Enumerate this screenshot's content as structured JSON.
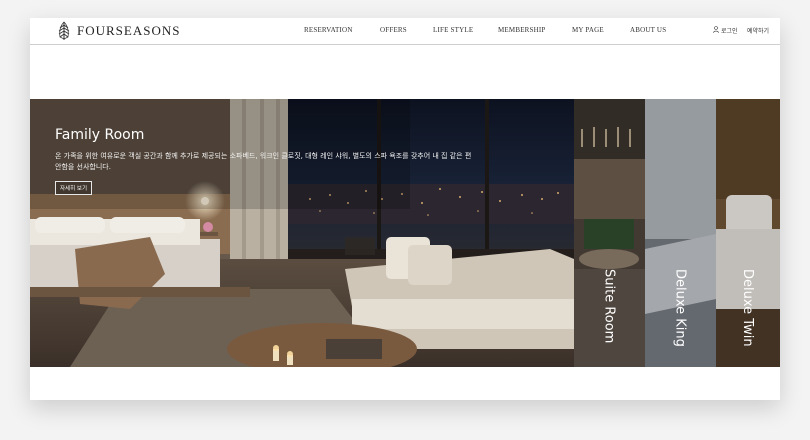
{
  "brand": {
    "name": "FOURSEASONS"
  },
  "nav": {
    "items": [
      "RESERVATION",
      "OFFERS",
      "LIFE STYLE",
      "MEMBERSHIP",
      "MY PAGE",
      "ABOUT US"
    ]
  },
  "utility": {
    "login_label": "로그인",
    "reserve_label": "예약하기"
  },
  "hero": {
    "active": {
      "title": "Family Room",
      "description": "온 가족을 위한 여유로운 객실 공간과 함께 추가로 제공되는 소파베드, 워크인 클로짓, 대형 레인 샤워, 별도의 스파 욕조를 갖추어 내 집 같은 편안함을 선사합니다.",
      "button_label": "자세히 보기"
    },
    "rooms": [
      {
        "label": "Suite Room"
      },
      {
        "label": "Deluxe King"
      },
      {
        "label": "Deluxe Twin"
      }
    ]
  },
  "icons": {
    "logo": "tree-leaf-logo-icon",
    "login": "user-icon"
  },
  "colors": {
    "header_border": "#cfcfcf",
    "text": "#333333",
    "overlay_text": "#ffffff"
  }
}
